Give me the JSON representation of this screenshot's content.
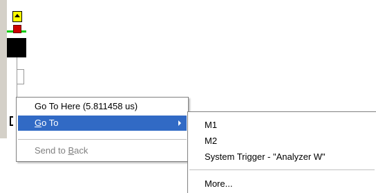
{
  "context_menu": {
    "items": [
      {
        "label": "Go To Here (5.811458 us)",
        "state": "normal"
      },
      {
        "label_prefix": "",
        "label_mnemonic": "G",
        "label_rest": "o To",
        "state": "selected",
        "has_submenu": true
      },
      {
        "label_prefix": "Send to ",
        "label_mnemonic": "B",
        "label_rest": "ack",
        "state": "disabled"
      }
    ]
  },
  "submenu": {
    "items": [
      {
        "label": "M1"
      },
      {
        "label": "M2"
      },
      {
        "label": "System Trigger - \"Analyzer W\""
      },
      {
        "label": "More..."
      }
    ]
  },
  "colors": {
    "selection": "#316ac5",
    "marker_yellow": "#ffff00",
    "marker_red": "#cc0000",
    "marker_green": "#00cc00"
  }
}
